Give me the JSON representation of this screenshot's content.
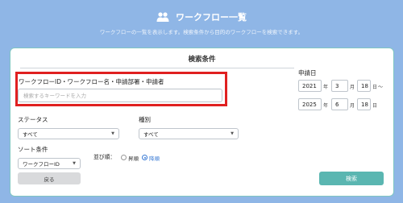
{
  "header": {
    "title": "ワークフロー一覧",
    "description": "ワークフローの一覧を表示します。検索条件から目的のワークフローを検索できます。",
    "icon": "users-icon"
  },
  "panel": {
    "title": "検索条件",
    "keyword": {
      "label": "ワークフローID・ワークフロー名・申請部署・申請者",
      "placeholder": "検索するキーワードを入力",
      "value": ""
    },
    "status": {
      "label": "ステータス",
      "value": "すべて"
    },
    "type": {
      "label": "種別",
      "value": "すべて"
    },
    "sort": {
      "label": "ソート条件",
      "value": "ワークフローID"
    },
    "order": {
      "label": "並び順：",
      "options": [
        "昇順",
        "降順"
      ],
      "selected": "降順"
    },
    "date": {
      "label": "申請日",
      "from": {
        "year": "2021",
        "month": "3",
        "day": "18"
      },
      "to": {
        "year": "2025",
        "month": "6",
        "day": "18"
      },
      "units": {
        "year": "年",
        "month": "月",
        "day": "日"
      },
      "separator": "〜"
    },
    "back_label": "戻る",
    "search_label": "検索"
  },
  "colors": {
    "header_bg": "#8fb6e6",
    "accent": "#5ab6b1",
    "highlight": "#e02020",
    "radio_selected": "#3a7bd5"
  }
}
